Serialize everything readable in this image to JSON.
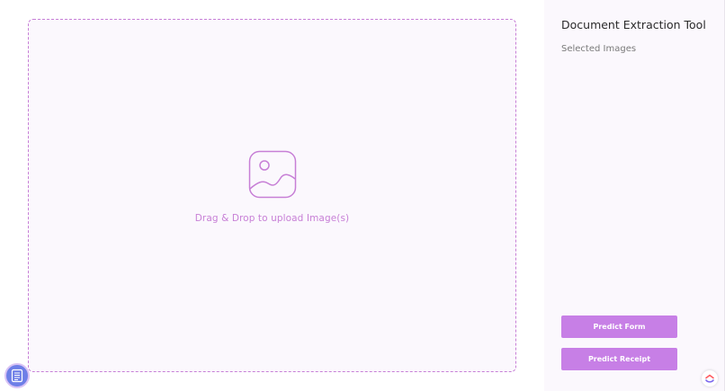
{
  "upload": {
    "text": "Drag & Drop to upload Image(s)",
    "icon": "image-icon"
  },
  "sidebar": {
    "title": "Document Extraction Tool",
    "subtitle": "Selected Images",
    "buttons": {
      "predict_form": "Predict Form",
      "predict_receipt": "Predict Receipt"
    }
  },
  "floating": {
    "left_icon": "notepad-icon",
    "right_icon": "clickup-logo-icon"
  },
  "colors": {
    "accent": "#c77fe6",
    "dropzone_border": "#c77fd6",
    "dropzone_bg": "#fbf8fd",
    "fab_left": "#6e7fe7"
  }
}
